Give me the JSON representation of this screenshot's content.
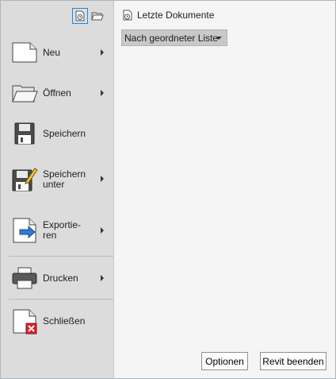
{
  "menu": {
    "items": [
      {
        "label": "Neu",
        "icon": "new-document-icon",
        "has_submenu": true
      },
      {
        "label": "Öffnen",
        "icon": "folder-open-icon",
        "has_submenu": true
      },
      {
        "label": "Speichern",
        "icon": "floppy-disk-icon",
        "has_submenu": false
      },
      {
        "label": "Speichern unter",
        "icon": "save-as-icon",
        "has_submenu": true
      },
      {
        "label": "Exportie-ren",
        "icon": "export-icon",
        "has_submenu": true
      },
      {
        "label": "Drucken",
        "icon": "printer-icon",
        "has_submenu": true
      },
      {
        "label": "Schließen",
        "icon": "close-document-icon",
        "has_submenu": false
      }
    ]
  },
  "recent": {
    "title": "Letzte Dokumente",
    "sort_value": "Nach geordneter Liste"
  },
  "footer": {
    "options_label": "Optionen",
    "exit_label": "Revit beenden"
  },
  "colors": {
    "accent_blue": "#3c7fb1",
    "close_red": "#d7232e",
    "sidebar_bg": "#dcdcdc"
  }
}
